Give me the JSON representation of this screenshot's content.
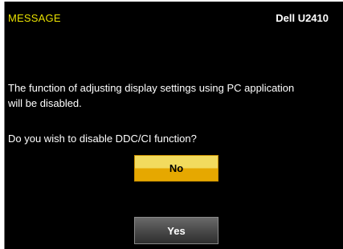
{
  "osd": {
    "title": "MESSAGE",
    "model": "Dell U2410",
    "message_line1": "The function of adjusting display settings using PC application",
    "message_line2": "will be disabled.",
    "question": "Do you wish to disable DDC/CI function?",
    "buttons": {
      "no_label": "No",
      "yes_label": "Yes"
    }
  },
  "colors": {
    "title": "#e8e000",
    "background": "#000000",
    "selected_button": "#e6a800",
    "unselected_button": "#4a4a4a"
  }
}
